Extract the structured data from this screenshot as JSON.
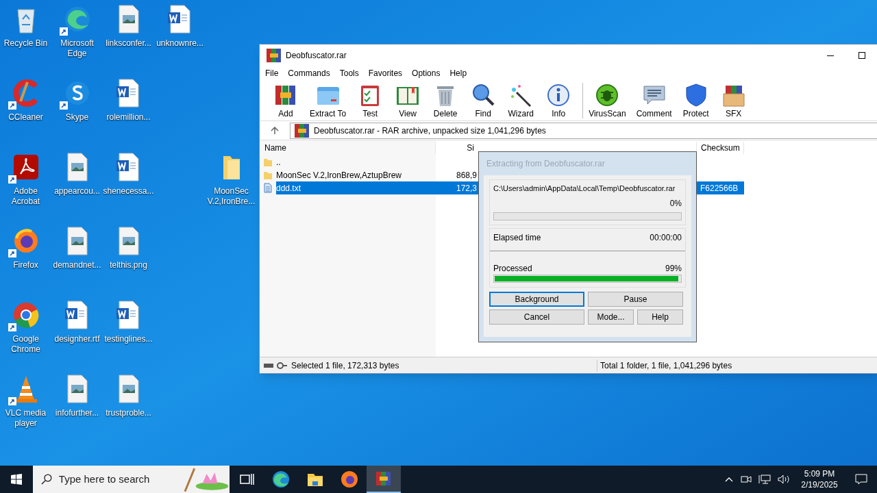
{
  "desktop_columns": [
    [
      {
        "label": "Recycle Bin",
        "kind": "recycle",
        "shortcut": false
      },
      {
        "label": "CCleaner",
        "kind": "ccleaner",
        "shortcut": true
      },
      {
        "label": "Adobe Acrobat",
        "kind": "acrobat",
        "shortcut": true
      },
      {
        "label": "Firefox",
        "kind": "firefox",
        "shortcut": true
      },
      {
        "label": "Google Chrome",
        "kind": "chrome",
        "shortcut": true
      },
      {
        "label": "VLC media player",
        "kind": "vlc",
        "shortcut": true
      }
    ],
    [
      {
        "label": "Microsoft Edge",
        "kind": "edge",
        "shortcut": true
      },
      {
        "label": "Skype",
        "kind": "skype",
        "shortcut": true
      },
      {
        "label": "appearcou...",
        "kind": "image",
        "shortcut": false
      },
      {
        "label": "demandnet...",
        "kind": "image",
        "shortcut": false
      },
      {
        "label": "designher.rtf",
        "kind": "word",
        "shortcut": false
      },
      {
        "label": "infofurther...",
        "kind": "image",
        "shortcut": false
      }
    ],
    [
      {
        "label": "linksconfer...",
        "kind": "image",
        "shortcut": false
      },
      {
        "label": "rolemillion...",
        "kind": "word",
        "shortcut": false
      },
      {
        "label": "shenecessa...",
        "kind": "word",
        "shortcut": false
      },
      {
        "label": "telthis.png",
        "kind": "image",
        "shortcut": false
      },
      {
        "label": "testinglines...",
        "kind": "word",
        "shortcut": false
      },
      {
        "label": "trustproble...",
        "kind": "image",
        "shortcut": false
      }
    ],
    [
      {
        "label": "unknownre...",
        "kind": "word",
        "shortcut": false
      }
    ],
    [
      null,
      null,
      {
        "label": "MoonSec V.2,IronBre...",
        "kind": "folder",
        "shortcut": false
      }
    ]
  ],
  "window": {
    "title": "Deobfuscator.rar",
    "menu": [
      "File",
      "Commands",
      "Tools",
      "Favorites",
      "Options",
      "Help"
    ],
    "toolbar": [
      {
        "label": "Add",
        "kind": "add"
      },
      {
        "label": "Extract To",
        "kind": "extract"
      },
      {
        "label": "Test",
        "kind": "test"
      },
      {
        "label": "View",
        "kind": "view"
      },
      {
        "label": "Delete",
        "kind": "delete"
      },
      {
        "label": "Find",
        "kind": "find"
      },
      {
        "label": "Wizard",
        "kind": "wizard"
      },
      {
        "label": "Info",
        "kind": "info"
      },
      {
        "label": "VirusScan",
        "kind": "virus"
      },
      {
        "label": "Comment",
        "kind": "comment"
      },
      {
        "label": "Protect",
        "kind": "protect"
      },
      {
        "label": "SFX",
        "kind": "sfx"
      }
    ],
    "address": "Deobfuscator.rar - RAR archive, unpacked size 1,041,296 bytes",
    "columns": [
      "Name",
      "Si",
      "Checksum"
    ],
    "rows": [
      {
        "name": "..",
        "kind": "folder",
        "size": "",
        "checksum": "",
        "selected": false
      },
      {
        "name": "MoonSec V.2,IronBrew,AztupBrew",
        "kind": "folder",
        "size": "868,9",
        "checksum": "",
        "selected": false
      },
      {
        "name": "ddd.txt",
        "kind": "file",
        "size": "172,3",
        "checksum": "F622566B",
        "selected": true
      }
    ],
    "status_left": "Selected 1 file, 172,313 bytes",
    "status_right": "Total 1 folder, 1 file, 1,041,296 bytes"
  },
  "dialog": {
    "title": "Extracting from Deobfuscator.rar",
    "path": "C:\\Users\\admin\\AppData\\Local\\Temp\\Deobfuscator.rar",
    "file_progress": {
      "percent": "0%",
      "level": 0
    },
    "elapsed_label": "Elapsed time",
    "elapsed": "00:00:00",
    "processed_label": "Processed",
    "processed_progress": {
      "percent": "99%",
      "level": 0.99
    },
    "buttons": [
      {
        "label": "Background",
        "focused": true
      },
      {
        "label": "Pause",
        "focused": false
      },
      {
        "label": "Cancel",
        "focused": false
      },
      {
        "label": "Mode...",
        "focused": false
      },
      {
        "label": "Help",
        "focused": false
      }
    ]
  },
  "taskbar": {
    "search_placeholder": "Type here to search",
    "apps": [
      {
        "kind": "taskview",
        "selected": false
      },
      {
        "kind": "edge",
        "selected": false
      },
      {
        "kind": "explorer",
        "selected": false
      },
      {
        "kind": "firefox",
        "selected": false
      },
      {
        "kind": "winrar",
        "selected": true
      }
    ],
    "time": "5:09 PM",
    "date": "2/19/2025"
  }
}
